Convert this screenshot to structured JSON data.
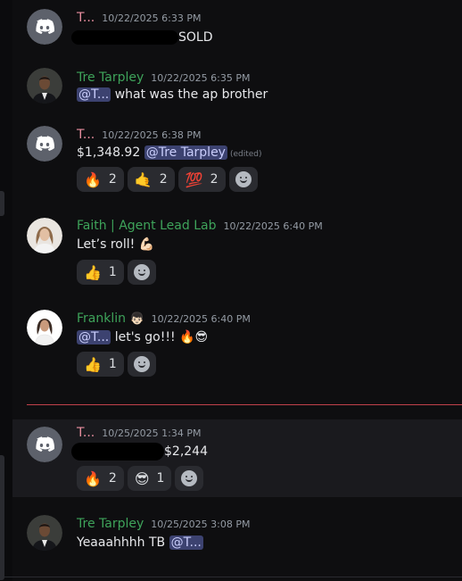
{
  "messages": [
    {
      "author": "T...",
      "timestamp": "10/22/2025 6:33 PM",
      "text": "SOLD"
    },
    {
      "author": "Tre Tarpley",
      "timestamp": "10/22/2025 6:35 PM",
      "mention": "@T...",
      "text": "what was the ap brother"
    },
    {
      "author": "T...",
      "timestamp": "10/22/2025 6:38 PM",
      "text": "$1,348.92",
      "mention": "@Tre Tarpley",
      "edited": "(edited)",
      "reactions": [
        {
          "emoji": "🔥",
          "count": "2"
        },
        {
          "emoji": "🤙",
          "count": "2"
        },
        {
          "emoji": "💯",
          "count": "2"
        }
      ]
    },
    {
      "author": "Faith | Agent Lead Lab",
      "timestamp": "10/22/2025 6:40 PM",
      "text": "Let’s roll! 💪🏻",
      "reactions": [
        {
          "emoji": "👍",
          "count": "1"
        }
      ]
    },
    {
      "author": "Franklin",
      "author_emoji": "👦🏻",
      "timestamp": "10/22/2025 6:40 PM",
      "mention": "@T...",
      "text": "let's go!!! 🔥😎",
      "reactions": [
        {
          "emoji": "👍",
          "count": "1"
        }
      ]
    },
    {
      "author": "T...",
      "timestamp": "10/25/2025 1:34 PM",
      "text": "$2,244",
      "reactions": [
        {
          "emoji": "🔥",
          "count": "2"
        },
        {
          "emoji": "😎",
          "count": "1"
        }
      ]
    },
    {
      "author": "Tre Tarpley",
      "timestamp": "10/25/2025 3:08 PM",
      "text": "Yeaaahhhh TB",
      "mention": "@T..."
    }
  ],
  "colors": {
    "background": "#0e0e10",
    "highlight": "#1a1a1e",
    "new_divider": "#c1414b",
    "name_pink": "#e98fa0",
    "name_green": "#3ea35a",
    "mention_bg": "#3c4270"
  },
  "icons": {
    "bot_avatar": "discord-logo-icon",
    "add_reaction": "add-reaction-smile-icon"
  }
}
